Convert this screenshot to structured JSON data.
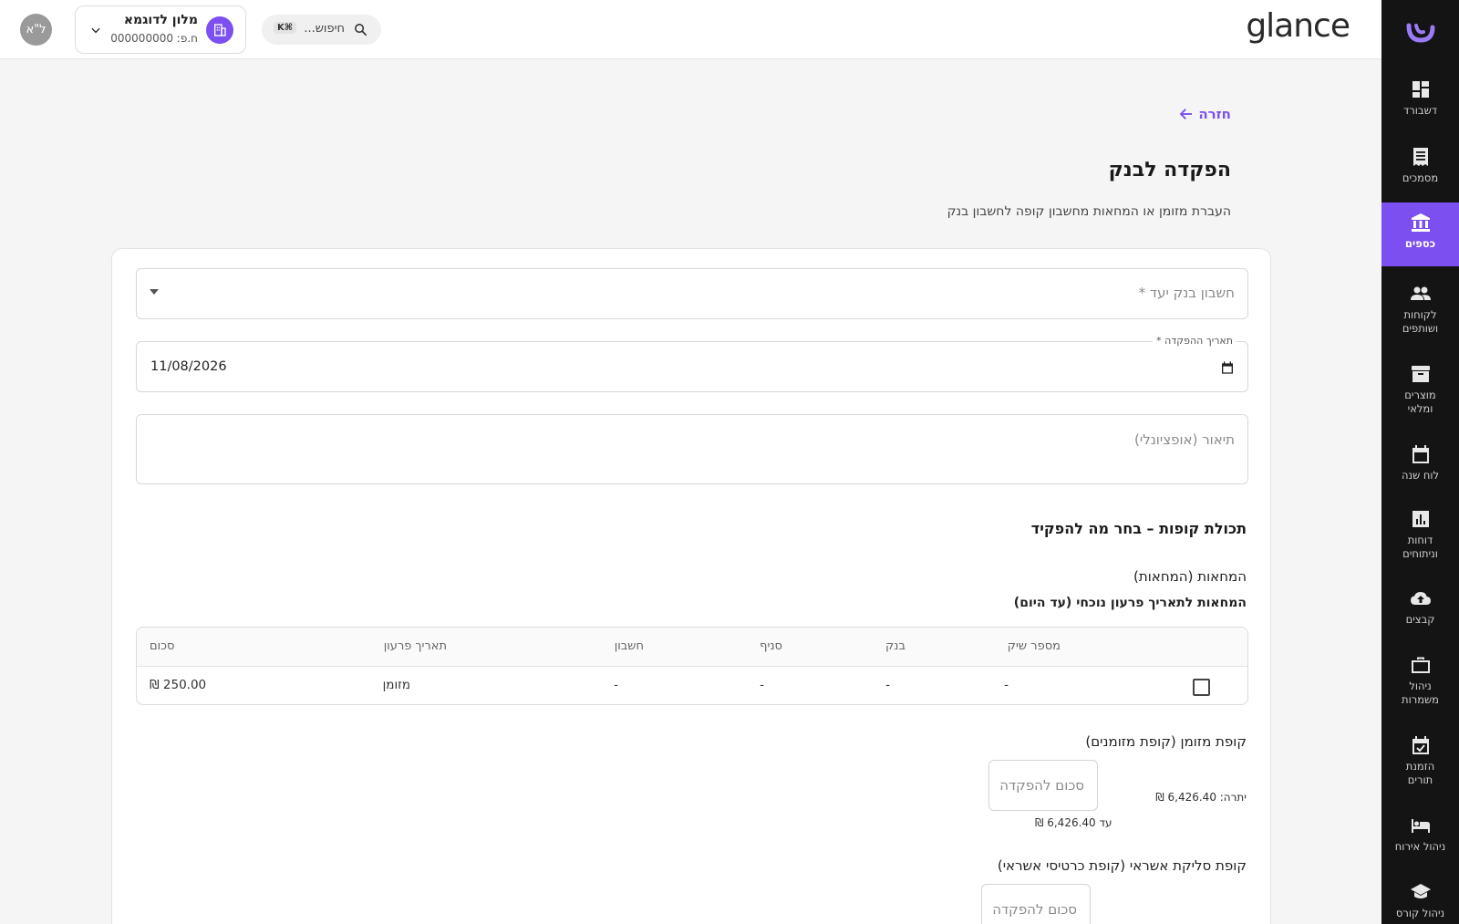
{
  "brand": "glance",
  "search": {
    "placeholder": "חיפוש...",
    "shortcut": "⌘K"
  },
  "hotel": {
    "name": "מלון לדוגמא",
    "vat": "ח.פ: 000000000"
  },
  "user": {
    "initials": "ל\"א"
  },
  "colors": {
    "accent": "#7b4ff0",
    "sidebar_bg": "#141414"
  },
  "sidebar": {
    "items": [
      {
        "label": "דשבורד",
        "icon": "dashboard-icon"
      },
      {
        "label": "מסמכים",
        "icon": "document-icon"
      },
      {
        "label": "כספים",
        "icon": "bank-icon",
        "active": true
      },
      {
        "label": "לקוחות ושותפים",
        "icon": "people-icon"
      },
      {
        "label": "מוצרים ומלאי",
        "icon": "archive-icon"
      },
      {
        "label": "לוח שנה",
        "icon": "calendar-icon"
      },
      {
        "label": "דוחות וניתוחים",
        "icon": "chart-icon"
      },
      {
        "label": "קבצים",
        "icon": "cloud-upload-icon"
      },
      {
        "label": "ניהול משמרות",
        "icon": "briefcase-icon"
      },
      {
        "label": "הזמנת תורים",
        "icon": "calendar-check-icon"
      },
      {
        "label": "ניהול אירוח",
        "icon": "bed-icon"
      },
      {
        "label": "ניהול קורס",
        "icon": "school-icon"
      }
    ]
  },
  "page": {
    "back": "חזרה",
    "title": "הפקדה לבנק",
    "subtitle": "העברת מזומן או המחאות מחשבון קופה לחשבון בנק"
  },
  "form": {
    "bank_account_placeholder": "חשבון בנק יעד *",
    "deposit_date_label": "תאריך ההפקדה *",
    "deposit_date_value": "11/08/2026",
    "description_placeholder": "תיאור (אופציונלי)"
  },
  "contents": {
    "title": "תכולת קופות – בחר מה להפקיד",
    "checks_heading": "המחאות (המחאות)",
    "checks_subheading": "המחאות לתאריך פרעון נוכחי (עד היום)",
    "table": {
      "columns": [
        "מספר שיק",
        "בנק",
        "סניף",
        "חשבון",
        "תאריך פרעון",
        "סכום"
      ],
      "rows": [
        {
          "check_no": "-",
          "bank": "-",
          "branch": "-",
          "account": "-",
          "due": "מזומן",
          "amount": "250.00 ₪"
        }
      ]
    },
    "cash_register": {
      "title": "קופת מזומן (קופת מזומנים)",
      "input_placeholder": "סכום להפקדה",
      "balance": "יתרה: 6,426.40 ₪",
      "up_to": "עד 6,426.40 ₪"
    },
    "credit_register": {
      "title": "קופת סליקת אשראי (קופת כרטיסי אשראי)",
      "input_placeholder": "סכום להפקדה"
    }
  }
}
